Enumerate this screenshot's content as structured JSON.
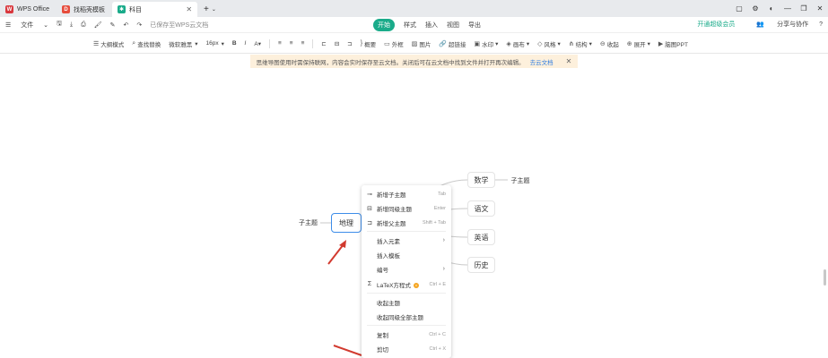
{
  "titlebar": {
    "tabs": [
      {
        "label": "WPS Office",
        "icon": "wps-logo-icon"
      },
      {
        "label": "找稻壳模板",
        "icon": "docer-logo-icon"
      },
      {
        "label": "科目",
        "icon": "mindmap-file-icon"
      }
    ],
    "new_tab": "+"
  },
  "menu": {
    "file": "文件",
    "save_status": "已保存至WPS云文档",
    "tabs": [
      "开始",
      "样式",
      "插入",
      "视图",
      "导出"
    ],
    "active_tab": "开始",
    "upgrade": "开通超级会员",
    "share": "分享与协作"
  },
  "toolbar": {
    "outline": "大纲模式",
    "find_replace": "查找替换",
    "font": "微软雅黑",
    "size": "16px",
    "summary": "概要",
    "frame": "外框",
    "image": "图片",
    "hyperlink": "超链接",
    "watermark": "水印",
    "canvas": "画布",
    "style": "风格",
    "structure": "结构",
    "collapse": "收起",
    "expand": "展开",
    "ppt": "脑图PPT"
  },
  "banner": {
    "text": "思维导图使用时需保持联网，内容会实时保存至云文档。关闭后可在云文档中找到文件并打开再次编辑。",
    "link": "去云文档"
  },
  "mindmap": {
    "root": "地理",
    "left_child": "子主题",
    "topics": [
      "数学",
      "语文",
      "英语",
      "历史"
    ],
    "math_child": "子主题"
  },
  "context_menu": {
    "add_child": {
      "label": "新增子主题",
      "shortcut": "Tab"
    },
    "add_sibling": {
      "label": "新增同级主题",
      "shortcut": "Enter"
    },
    "add_parent": {
      "label": "新增父主题",
      "shortcut": "Shift + Tab"
    },
    "insert_element": {
      "label": "插入元素"
    },
    "insert_template": {
      "label": "插入模板"
    },
    "numbering": {
      "label": "编号"
    },
    "latex": {
      "label": "LaTeX方程式",
      "shortcut": "Ctrl + E"
    },
    "collapse_topic": {
      "label": "收起主题"
    },
    "collapse_siblings": {
      "label": "收起同级全部主题"
    },
    "copy": {
      "label": "复制",
      "shortcut": "Ctrl + C"
    },
    "cut": {
      "label": "剪切",
      "shortcut": "Ctrl + X"
    }
  },
  "colors": {
    "accent": "#1aab8a",
    "root_border": "#3d8de9",
    "arrow": "#d23a2f",
    "banner_bg": "#fdf0dc"
  }
}
